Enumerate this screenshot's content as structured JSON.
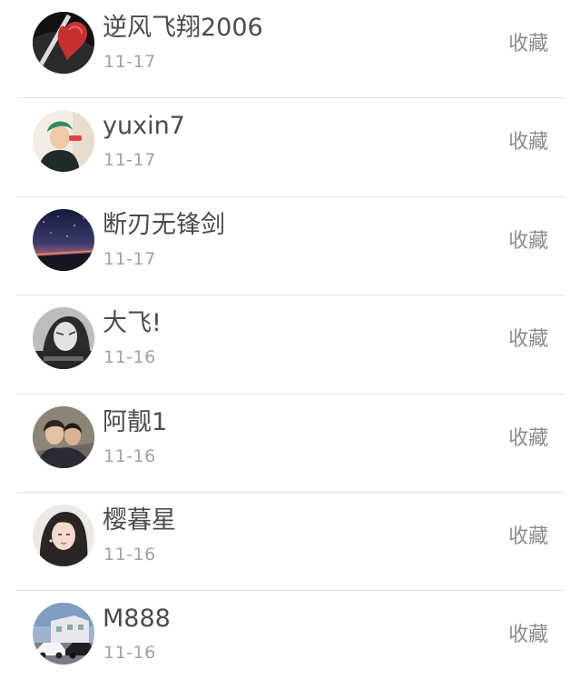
{
  "items": [
    {
      "username": "逆风飞翔2006",
      "date": "11-17",
      "action": "收藏",
      "avatar_icon": "red-heart-dark-avatar"
    },
    {
      "username": "yuxin7",
      "date": "11-17",
      "action": "收藏",
      "avatar_icon": "green-hair-person-avatar"
    },
    {
      "username": "断刃无锋剑",
      "date": "11-17",
      "action": "收藏",
      "avatar_icon": "night-sky-avatar"
    },
    {
      "username": "大飞!",
      "date": "11-16",
      "action": "收藏",
      "avatar_icon": "bw-portrait-avatar"
    },
    {
      "username": "阿靓1",
      "date": "11-16",
      "action": "收藏",
      "avatar_icon": "couple-photo-avatar"
    },
    {
      "username": "樱暮星",
      "date": "11-16",
      "action": "收藏",
      "avatar_icon": "girl-portrait-avatar"
    },
    {
      "username": "M888",
      "date": "11-16",
      "action": "收藏",
      "avatar_icon": "car-street-avatar"
    }
  ],
  "colors": {
    "username": "#4b4b4b",
    "date": "#a2a2a2",
    "action": "#8c8c8c",
    "divider": "#e3e3e3"
  }
}
